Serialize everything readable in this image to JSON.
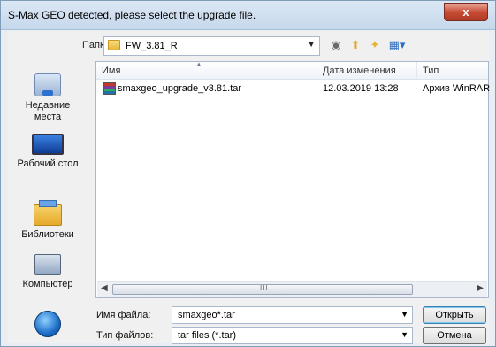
{
  "window": {
    "title": "S-Max GEO detected, please select the upgrade file.",
    "close_label": "x"
  },
  "folder": {
    "label": "Папка:",
    "current": "FW_3.81_R"
  },
  "toolbar": {
    "icons": [
      "back-icon",
      "up-folder-icon",
      "new-folder-icon",
      "view-menu-icon"
    ]
  },
  "places": [
    {
      "label": "Недавние места",
      "icon": "recent-places-icon"
    },
    {
      "label": "Рабочий стол",
      "icon": "desktop-icon"
    },
    {
      "label": "Библиотеки",
      "icon": "libraries-icon"
    },
    {
      "label": "Компьютер",
      "icon": "computer-icon"
    },
    {
      "label": "",
      "icon": "network-icon"
    }
  ],
  "filelist": {
    "columns": [
      "Имя",
      "Дата изменения",
      "Тип"
    ],
    "rows": [
      {
        "name": "smaxgeo_upgrade_v3.81.tar",
        "date": "12.03.2019 13:28",
        "type": "Архив WinRAR"
      }
    ],
    "scroll_grip": "III"
  },
  "filename": {
    "label": "Имя файла:",
    "value": "smaxgeo*.tar"
  },
  "filetype": {
    "label": "Тип файлов:",
    "value": "tar files (*.tar)"
  },
  "buttons": {
    "open": "Открыть",
    "cancel": "Отмена"
  }
}
